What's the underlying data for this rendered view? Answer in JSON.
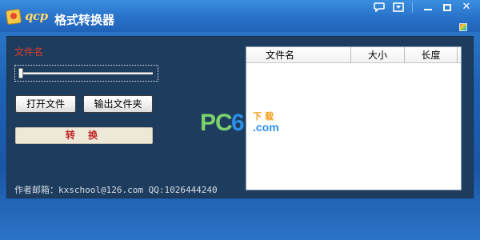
{
  "window": {
    "brand": "qcp",
    "title": "格式转换器",
    "controls": {
      "chat_icon": "chat-bubble-icon",
      "menu_icon": "dropdown-menu-icon",
      "minimize_icon": "minimize-icon",
      "maximize_icon": "maximize-icon",
      "close_label": "✕"
    },
    "skin_icon": "color-palette-icon"
  },
  "main": {
    "file_label": "文件名",
    "progress_fraction": 0.0,
    "buttons": {
      "open_file": "打开文件",
      "output_folder": "输出文件夹",
      "convert": "转 换"
    },
    "author_line": "作者邮箱：kxschool@126.com QQ:1026444240"
  },
  "file_list": {
    "columns": [
      "文件名",
      "大小",
      "长度"
    ],
    "rows": []
  },
  "watermark": {
    "pc": "PC",
    "six": "6",
    "download": "下载",
    "com": ".com"
  },
  "colors": {
    "panel_bg": "#1e3d5e",
    "file_label": "#e03a2a",
    "convert_text": "#c0282a",
    "window_blue": "#1f62b6"
  }
}
